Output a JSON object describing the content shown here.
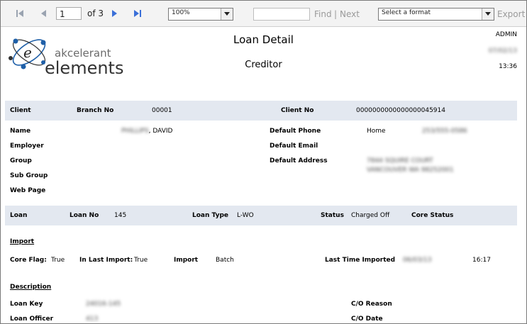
{
  "toolbar": {
    "page_value": "1",
    "of_pages": "of 3",
    "zoom_value": "100%",
    "find_label": "Find",
    "separator": "|",
    "next_label": "Next",
    "format_placeholder": "Select a format",
    "export_label": "Export"
  },
  "header": {
    "title": "Loan Detail",
    "subtitle": "Creditor",
    "user": "ADMIN",
    "date": "07/02/13",
    "time": "13:36",
    "logo_text_top": "akcelerant",
    "logo_text_bottom": "elements",
    "logo_glyph": "e"
  },
  "client_band": {
    "client_label": "Client",
    "branch_no_label": "Branch No",
    "branch_no_value": "00001",
    "client_no_label": "Client No",
    "client_no_value": "0000000000000000045914"
  },
  "client_info": {
    "name_label": "Name",
    "name_blur": "PHILLIPS",
    "name_suffix": ", DAVID",
    "employer_label": "Employer",
    "group_label": "Group",
    "subgroup_label": "Sub Group",
    "webpage_label": "Web Page",
    "phone_label": "Default Phone",
    "phone_type": "Home",
    "phone_value": "253/555-0586",
    "email_label": "Default Email",
    "address_label": "Default Address",
    "address_line1": "7844 SQUIRE COURT",
    "address_line2": "VANCOUVER WA 98252001"
  },
  "loan_band": {
    "loan_label": "Loan",
    "loan_no_label": "Loan No",
    "loan_no_value": "145",
    "loan_type_label": "Loan Type",
    "loan_type_value": "L-WO",
    "status_label": "Status",
    "status_value": "Charged Off",
    "core_status_label": "Core Status"
  },
  "import": {
    "section_title": "Import",
    "core_flag_label": "Core Flag:",
    "core_flag_value": "True",
    "in_last_import_label": "In Last Import:",
    "in_last_import_value": "True",
    "import_label": "Import",
    "import_value": "Batch",
    "last_time_label": "Last Time Imported",
    "last_time_date": "06/03/13",
    "last_time_time": "16:17"
  },
  "description": {
    "section_title": "Description",
    "loan_key_label": "Loan Key",
    "loan_key_value": "24016-145",
    "loan_officer_label": "Loan Officer",
    "loan_officer_value": "413",
    "co_reason_label": "C/O Reason",
    "co_date_label": "C/O Date"
  },
  "colors": {
    "band": "#e3e8f0",
    "nav_active": "#3a6fd8",
    "nav_disabled": "#9aa3b0",
    "logo_blue": "#1e5fa8"
  }
}
